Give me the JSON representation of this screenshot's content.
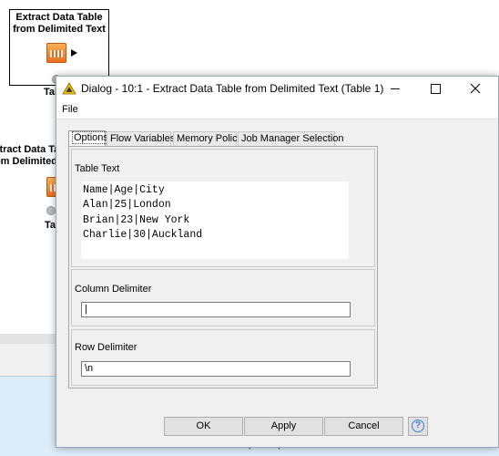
{
  "workflow": {
    "node1": {
      "title_line1": "Extract Data Table",
      "title_line2": "from Delimited Text",
      "label": "Table"
    },
    "node2": {
      "title_line1": "Extract Data Table",
      "title_line2": "from Delimited Text",
      "label": "Table"
    },
    "console_line": "Unhandled event loop exception"
  },
  "dialog": {
    "title": "Dialog - 10:1 - Extract Data Table from Delimited Text (Table 1)",
    "menu": {
      "file": "File"
    },
    "tabs": [
      {
        "label": "Options",
        "active": true
      },
      {
        "label": "Flow Variables",
        "active": false
      },
      {
        "label": "Memory Policy",
        "active": false
      },
      {
        "label": "Job Manager Selection",
        "active": false
      }
    ],
    "table_text": {
      "label": "Table Text",
      "value": "Name|Age|City\nAlan|25|London\nBrian|23|New York\nCharlie|30|Auckland"
    },
    "column_delimiter": {
      "label": "Column Delimiter",
      "value": "|"
    },
    "row_delimiter": {
      "label": "Row Delimiter",
      "value": "\\n"
    },
    "buttons": {
      "ok": "OK",
      "apply": "Apply",
      "cancel": "Cancel",
      "help": "?"
    }
  },
  "icons": {
    "title_icon": "knime-triangle-icon",
    "minimize": "minimize-icon",
    "maximize": "maximize-icon",
    "close": "close-icon",
    "help": "help-icon"
  },
  "colors": {
    "accent": "#3a7bd5",
    "node_orange": "#e96c1b",
    "knime_yellow": "#f5c400"
  }
}
